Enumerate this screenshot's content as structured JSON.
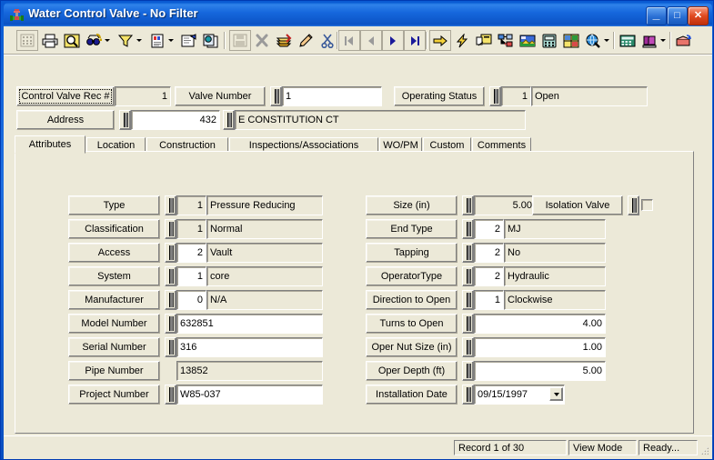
{
  "window": {
    "title": "Water Control Valve - No Filter",
    "icon": "valve-icon",
    "minimize_label": "_",
    "maximize_label": "□",
    "close_label": "✕"
  },
  "toolbar": {
    "items": [
      {
        "name": "grid-view-icon",
        "enabled": false
      },
      {
        "name": "print-icon",
        "enabled": true
      },
      {
        "name": "print-preview-icon",
        "enabled": true
      },
      {
        "name": "find-icon",
        "enabled": true,
        "dropdown": true
      },
      {
        "name": "filter-icon",
        "enabled": true,
        "dropdown": true
      },
      {
        "name": "report-icon",
        "enabled": true,
        "dropdown": true
      },
      {
        "name": "query-icon",
        "enabled": true
      },
      {
        "name": "copy-records-icon",
        "enabled": true
      },
      {
        "name": "save-icon",
        "enabled": false
      },
      {
        "name": "delete-icon",
        "enabled": false
      },
      {
        "name": "undo-icon",
        "enabled": true
      },
      {
        "name": "edit-icon",
        "enabled": true
      },
      {
        "name": "cut-icon",
        "enabled": true
      },
      {
        "name": "first-record-icon",
        "enabled": false
      },
      {
        "name": "previous-record-icon",
        "enabled": false
      },
      {
        "name": "next-record-icon",
        "enabled": true
      },
      {
        "name": "last-record-icon",
        "enabled": true
      },
      {
        "name": "goto-icon",
        "enabled": true
      },
      {
        "name": "lightning-icon",
        "enabled": true
      },
      {
        "name": "workorder-icon",
        "enabled": true
      },
      {
        "name": "hierarchy-icon",
        "enabled": true
      },
      {
        "name": "map-icon",
        "enabled": true
      },
      {
        "name": "phone-icon",
        "enabled": true
      },
      {
        "name": "gis-icon",
        "enabled": true
      },
      {
        "name": "globe-search-icon",
        "enabled": true,
        "dropdown": true
      },
      {
        "name": "calculator-icon",
        "enabled": true
      },
      {
        "name": "help-book-icon",
        "enabled": true,
        "dropdown": true
      },
      {
        "name": "exit-icon",
        "enabled": true
      }
    ]
  },
  "header": {
    "record_label": "Control Valve Rec #",
    "record_value": "1",
    "valve_number_label": "Valve Number",
    "valve_number_value": "1",
    "operating_status_label": "Operating Status",
    "operating_status_code": "1",
    "operating_status_text": "Open",
    "address_label": "Address",
    "address_number": "432",
    "address_street": "E CONSTITUTION CT"
  },
  "tabs": [
    {
      "label": "Attributes",
      "selected": true
    },
    {
      "label": "Location",
      "selected": false
    },
    {
      "label": "Construction",
      "selected": false
    },
    {
      "label": "Inspections/Associations",
      "selected": false
    },
    {
      "label": "WO/PM",
      "selected": false
    },
    {
      "label": "Custom",
      "selected": false
    },
    {
      "label": "Comments",
      "selected": false
    }
  ],
  "attributes": {
    "left_fields": [
      {
        "label": "Type",
        "code": "1",
        "code_readonly": true,
        "text": "Pressure Reducing",
        "text_readonly": true,
        "has_spin": true,
        "kind": "code_text"
      },
      {
        "label": "Classification",
        "code": "1",
        "code_readonly": true,
        "text": "Normal",
        "text_readonly": true,
        "has_spin": true,
        "kind": "code_text"
      },
      {
        "label": "Access",
        "code": "2",
        "code_readonly": false,
        "text": "Vault",
        "text_readonly": true,
        "has_spin": true,
        "kind": "code_text"
      },
      {
        "label": "System",
        "code": "1",
        "code_readonly": false,
        "text": "core",
        "text_readonly": true,
        "has_spin": true,
        "kind": "code_text"
      },
      {
        "label": "Manufacturer",
        "code": "0",
        "code_readonly": false,
        "text": "N/A",
        "text_readonly": true,
        "has_spin": true,
        "kind": "code_text"
      },
      {
        "label": "Model Number",
        "value": "632851",
        "readonly": false,
        "has_spin": true,
        "kind": "text"
      },
      {
        "label": "Serial Number",
        "value": "316",
        "readonly": false,
        "has_spin": true,
        "kind": "text"
      },
      {
        "label": "Pipe Number",
        "value": "13852",
        "readonly": true,
        "has_spin": false,
        "kind": "text"
      },
      {
        "label": "Project Number",
        "value": "W85-037",
        "readonly": false,
        "has_spin": true,
        "kind": "text"
      }
    ],
    "right_fields": [
      {
        "label": "Size (in)",
        "value": "5.00",
        "readonly": true,
        "has_spin": true,
        "kind": "num"
      },
      {
        "label": "End Type",
        "code": "2",
        "code_readonly": false,
        "text": "MJ",
        "text_readonly": true,
        "has_spin": true,
        "kind": "code_text"
      },
      {
        "label": "Tapping",
        "code": "2",
        "code_readonly": false,
        "text": "No",
        "text_readonly": true,
        "has_spin": true,
        "kind": "code_text"
      },
      {
        "label": "OperatorType",
        "code": "2",
        "code_readonly": false,
        "text": "Hydraulic",
        "text_readonly": true,
        "has_spin": true,
        "kind": "code_text"
      },
      {
        "label": "Direction to Open",
        "code": "1",
        "code_readonly": false,
        "text": "Clockwise",
        "text_readonly": true,
        "has_spin": true,
        "kind": "code_text"
      },
      {
        "label": "Turns to Open",
        "value": "4.00",
        "readonly": false,
        "has_spin": true,
        "kind": "num"
      },
      {
        "label": "Oper Nut Size (in)",
        "value": "1.00",
        "readonly": false,
        "has_spin": true,
        "kind": "num"
      },
      {
        "label": "Oper Depth (ft)",
        "value": "5.00",
        "readonly": false,
        "has_spin": true,
        "kind": "num"
      },
      {
        "label": "Installation Date",
        "value": "09/15/1997",
        "readonly": false,
        "has_spin": true,
        "kind": "date"
      }
    ],
    "isolation_valve": {
      "label": "Isolation Valve",
      "checked": false
    }
  },
  "statusbar": {
    "record_position": "Record 1 of 30",
    "mode": "View Mode",
    "state": "Ready..."
  },
  "colors": {
    "face": "#ece9d8",
    "title_blue": "#0a5bd3",
    "close_red": "#e04a20",
    "field_white": "#ffffff",
    "shadow": "#808080"
  }
}
